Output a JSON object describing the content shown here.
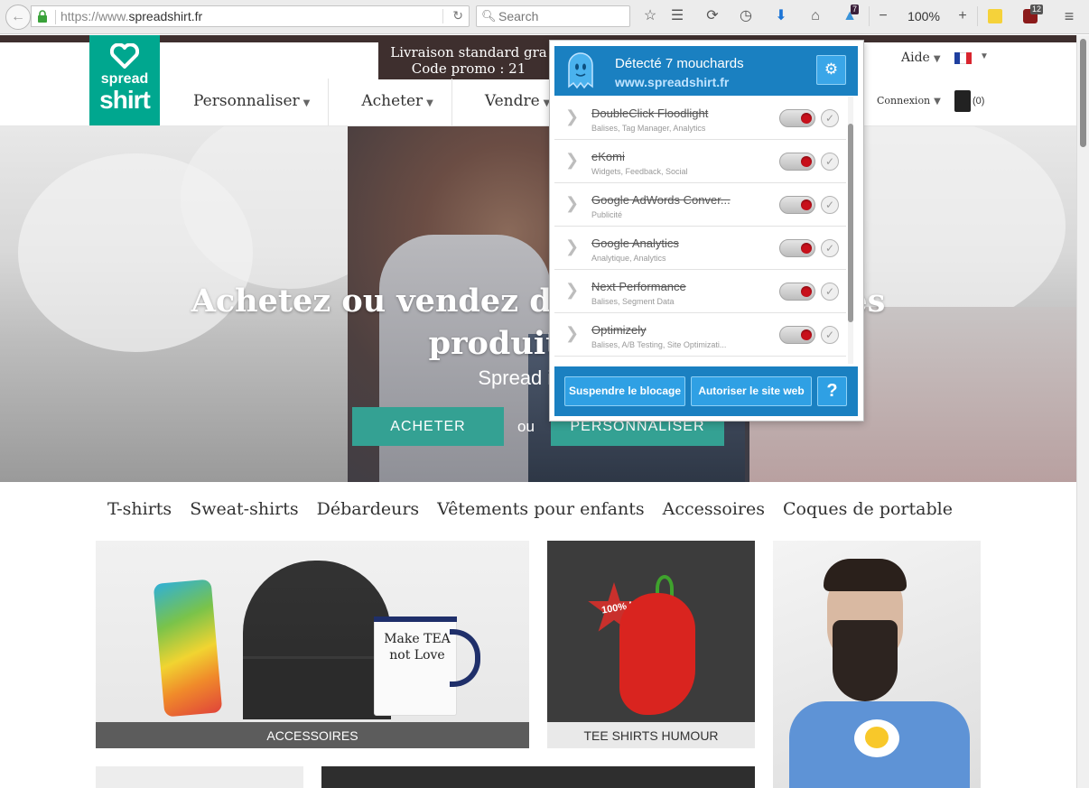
{
  "browser": {
    "url_prefix": "https://www.",
    "url_domain": "spreadshirt.fr",
    "search_placeholder": "Search",
    "zoom": "100%",
    "ghostery_badge": "7",
    "ublock_badge": "12"
  },
  "site": {
    "logo_line1": "spread",
    "logo_line2": "shirt",
    "promo_line1": "Livraison standard gra",
    "promo_line2": "Code promo : 21",
    "nav": [
      {
        "label": "Personnaliser"
      },
      {
        "label": "Acheter"
      },
      {
        "label": "Vendre"
      }
    ],
    "aide": "Aide",
    "connexion": "Connexion",
    "cart_count": "(0)"
  },
  "hero": {
    "title_line1": "Achetez ou vendez des de            ur des",
    "title_line2": "produits per",
    "subtitle": "Spread it with",
    "btn_acheter": "ACHETER",
    "ou": "ou",
    "btn_personnaliser": "PERSONNALISER"
  },
  "categories": [
    "T-shirts",
    "Sweat-shirts",
    "Débardeurs",
    "Vêtements pour enfants",
    "Accessoires",
    "Coques de portable"
  ],
  "tiles": {
    "accessoires": "ACCESSOIRES",
    "humour": "TEE SHIRTS HUMOUR",
    "mug_text": "Make TEA not Love",
    "hot_text": "100% HOT"
  },
  "ghostery": {
    "title": "Détecté 7 mouchards",
    "site": "www.spreadshirt.fr",
    "trackers": [
      {
        "name": "DoubleClick Floodlight",
        "cats": "Balises, Tag Manager, Analytics"
      },
      {
        "name": "eKomi",
        "cats": "Widgets, Feedback, Social"
      },
      {
        "name": "Google AdWords Conver...",
        "cats": "Publicité"
      },
      {
        "name": "Google Analytics",
        "cats": "Analytique, Analytics"
      },
      {
        "name": "Next Performance",
        "cats": "Balises, Segment Data"
      },
      {
        "name": "Optimizely",
        "cats": "Balises, A/B Testing, Site Optimizati..."
      }
    ],
    "btn_pause": "Suspendre le blocage",
    "btn_trust": "Autoriser le site web",
    "btn_help": "?"
  },
  "colors": {
    "brand_teal": "#00a78f",
    "cta_teal": "#34a193",
    "ghostery_blue": "#1a80c1",
    "promo_brown": "#3e2f2e"
  }
}
